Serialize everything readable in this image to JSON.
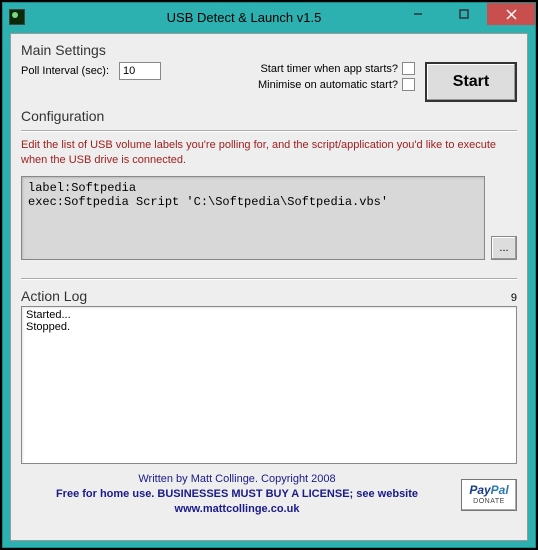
{
  "window": {
    "title": "USB Detect & Launch v1.5"
  },
  "mainSettings": {
    "heading": "Main Settings",
    "pollLabel": "Poll Interval (sec):",
    "pollValue": "10",
    "startTimerLabel": "Start timer when app starts?",
    "minimiseLabel": "Minimise on automatic start?",
    "startButton": "Start"
  },
  "configuration": {
    "heading": "Configuration",
    "hint": "Edit the list of USB volume labels you're polling for, and the script/application you'd like to execute when the USB drive is connected.",
    "text": "label:Softpedia\nexec:Softpedia Script 'C:\\Softpedia\\Softpedia.vbs'",
    "browseLabel": "..."
  },
  "actionLog": {
    "heading": "Action Log",
    "count": "9",
    "lines": "Started...\nStopped."
  },
  "footer": {
    "line1": "Written by Matt Collinge. Copyright 2008",
    "line2": "Free for home use. BUSINESSES MUST BUY A LICENSE; see website",
    "line3": "www.mattcollinge.co.uk",
    "paypalBrand1": "Pay",
    "paypalBrand2": "Pal",
    "paypalDonate": "DONATE"
  }
}
